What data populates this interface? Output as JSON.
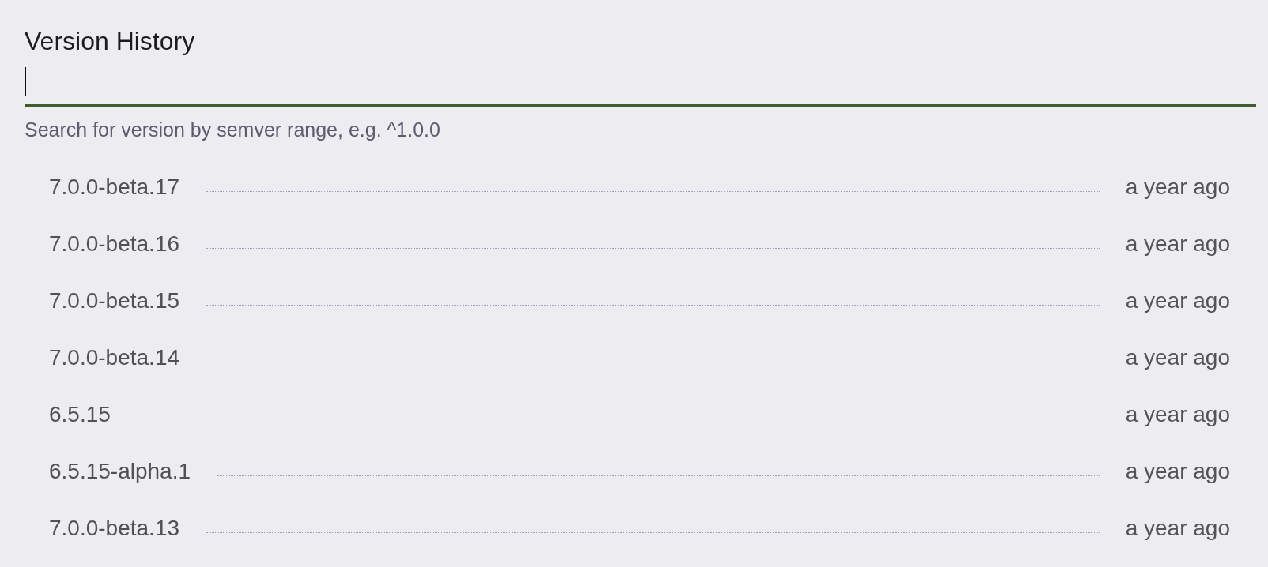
{
  "title": "Version History",
  "search": {
    "focused": true,
    "helper": "Search for version by semver range, e.g. ^1.0.0"
  },
  "versions": [
    {
      "version": "7.0.0-beta.17",
      "published": "a year ago"
    },
    {
      "version": "7.0.0-beta.16",
      "published": "a year ago"
    },
    {
      "version": "7.0.0-beta.15",
      "published": "a year ago"
    },
    {
      "version": "7.0.0-beta.14",
      "published": "a year ago"
    },
    {
      "version": "6.5.15",
      "published": "a year ago"
    },
    {
      "version": "6.5.15-alpha.1",
      "published": "a year ago"
    },
    {
      "version": "7.0.0-beta.13",
      "published": "a year ago"
    }
  ]
}
